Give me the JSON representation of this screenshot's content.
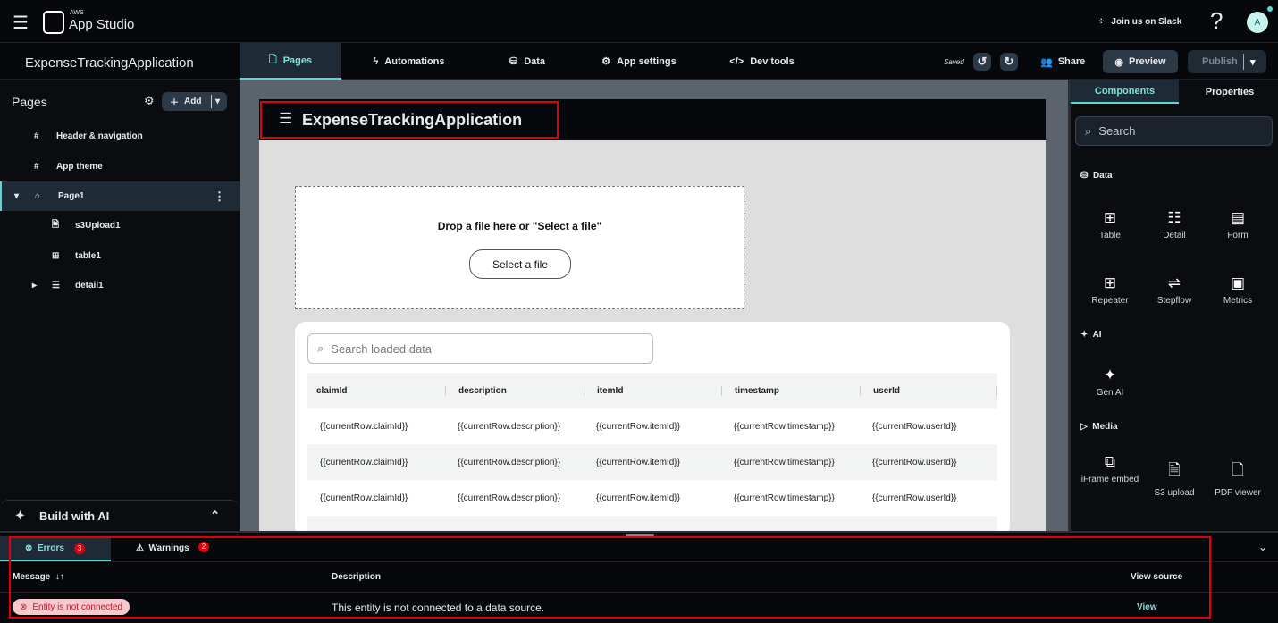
{
  "topbar": {
    "brand_small": "AWS",
    "brand": "App Studio",
    "slack": "Join us on Slack",
    "help": "?",
    "avatar": "A"
  },
  "appname": "ExpenseTrackingApplication",
  "tabs": [
    {
      "label": "Pages",
      "icon": "page-icon"
    },
    {
      "label": "Automations",
      "icon": "bolt-icon"
    },
    {
      "label": "Data",
      "icon": "database-icon"
    },
    {
      "label": "App settings",
      "icon": "gear-icon"
    },
    {
      "label": "Dev tools",
      "icon": "code-icon"
    }
  ],
  "toolbar": {
    "saved": "Saved",
    "share": "Share",
    "preview": "Preview",
    "publish": "Publish"
  },
  "sidebar": {
    "title": "Pages",
    "add": "Add",
    "items": [
      "Header & navigation",
      "App theme",
      "Page1",
      "s3Upload1",
      "table1",
      "detail1"
    ],
    "build_ai": "Build with AI"
  },
  "app": {
    "title": "ExpenseTrackingApplication",
    "drop_text": "Drop a file here or \"Select a file\"",
    "select_btn": "Select a file",
    "search_placeholder": "Search loaded data",
    "columns": [
      "claimId",
      "description",
      "itemId",
      "timestamp",
      "userId"
    ],
    "rows": [
      [
        "{{currentRow.claimId}}",
        "{{currentRow.description}}",
        "{{currentRow.itemId}}",
        "{{currentRow.timestamp}}",
        "{{currentRow.userId}}"
      ],
      [
        "{{currentRow.claimId}}",
        "{{currentRow.description}}",
        "{{currentRow.itemId}}",
        "{{currentRow.timestamp}}",
        "{{currentRow.userId}}"
      ],
      [
        "{{currentRow.claimId}}",
        "{{currentRow.description}}",
        "{{currentRow.itemId}}",
        "{{currentRow.timestamp}}",
        "{{currentRow.userId}}"
      ]
    ]
  },
  "right": {
    "tabs": [
      "Components",
      "Properties"
    ],
    "search": "Search",
    "sections": {
      "data": "Data",
      "ai": "AI",
      "media": "Media"
    },
    "data_items": [
      "Table",
      "Detail",
      "Form",
      "Repeater",
      "Stepflow",
      "Metrics"
    ],
    "ai_items": [
      "Gen AI"
    ],
    "media_items": [
      "iFrame embed",
      "S3 upload",
      "PDF viewer"
    ]
  },
  "bottom": {
    "errors": "Errors",
    "errors_count": "3",
    "warnings": "Warnings",
    "warnings_count": "2",
    "col_message": "Message",
    "col_description": "Description",
    "col_view": "View source",
    "row": {
      "message": "Entity is not connected",
      "description": "This entity is not connected to a data source.",
      "view": "View"
    }
  },
  "colors": {
    "accent": "#5fd6cf",
    "error": "#e0000b",
    "badge_bg": "#f8c9cc"
  }
}
